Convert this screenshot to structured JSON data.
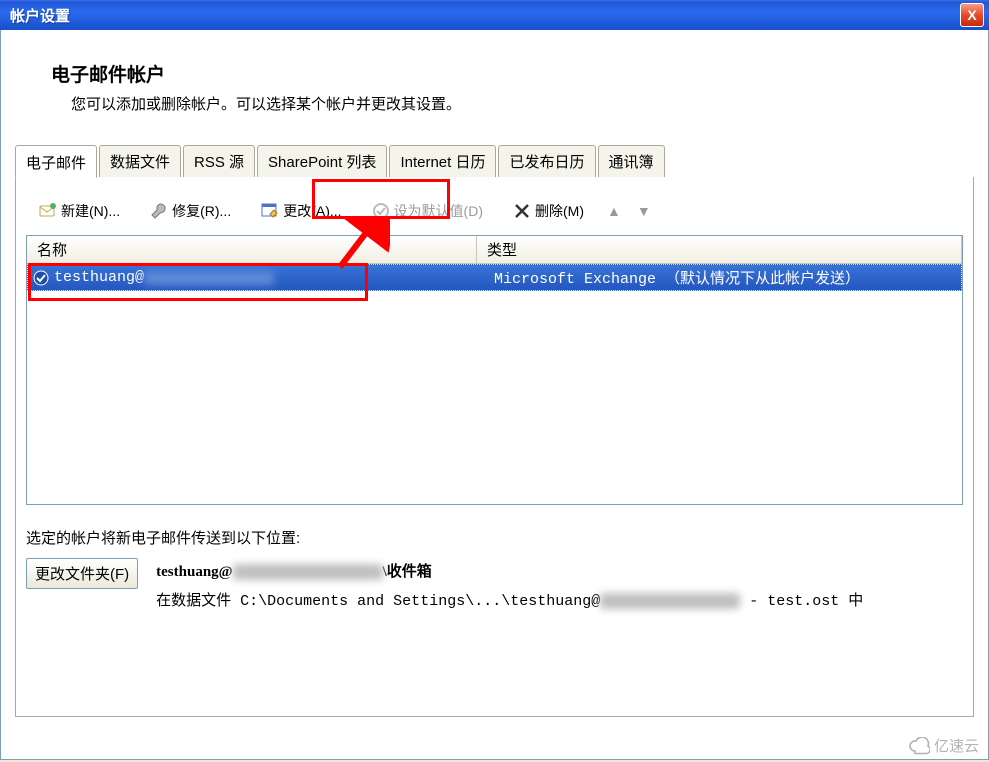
{
  "window": {
    "title": "帐户设置",
    "close_label": "X"
  },
  "header": {
    "title": "电子邮件帐户",
    "subtitle": "您可以添加或删除帐户。可以选择某个帐户并更改其设置。"
  },
  "tabs": [
    {
      "label": "电子邮件",
      "active": true
    },
    {
      "label": "数据文件",
      "active": false
    },
    {
      "label": "RSS 源",
      "active": false
    },
    {
      "label": "SharePoint 列表",
      "active": false
    },
    {
      "label": "Internet 日历",
      "active": false
    },
    {
      "label": "已发布日历",
      "active": false
    },
    {
      "label": "通讯簿",
      "active": false
    }
  ],
  "toolbar": {
    "new_label": "新建(N)...",
    "repair_label": "修复(R)...",
    "change_label": "更改(A)...",
    "default_label": "设为默认值(D)",
    "delete_label": "删除(M)"
  },
  "list": {
    "col_name": "名称",
    "col_type": "类型",
    "rows": [
      {
        "name_prefix": "testhuang@",
        "type": "Microsoft Exchange （默认情况下从此帐户发送）"
      }
    ]
  },
  "delivery": {
    "intro": "选定的帐户将新电子邮件传送到以下位置:",
    "change_folder_btn": "更改文件夹(F)",
    "mailbox_prefix": "testhuang@",
    "mailbox_suffix": "\\收件箱",
    "datafile_prefix": "在数据文件 C:\\Documents and Settings\\...\\testhuang@",
    "datafile_suffix": " - test.ost 中"
  },
  "watermark": "亿速云"
}
